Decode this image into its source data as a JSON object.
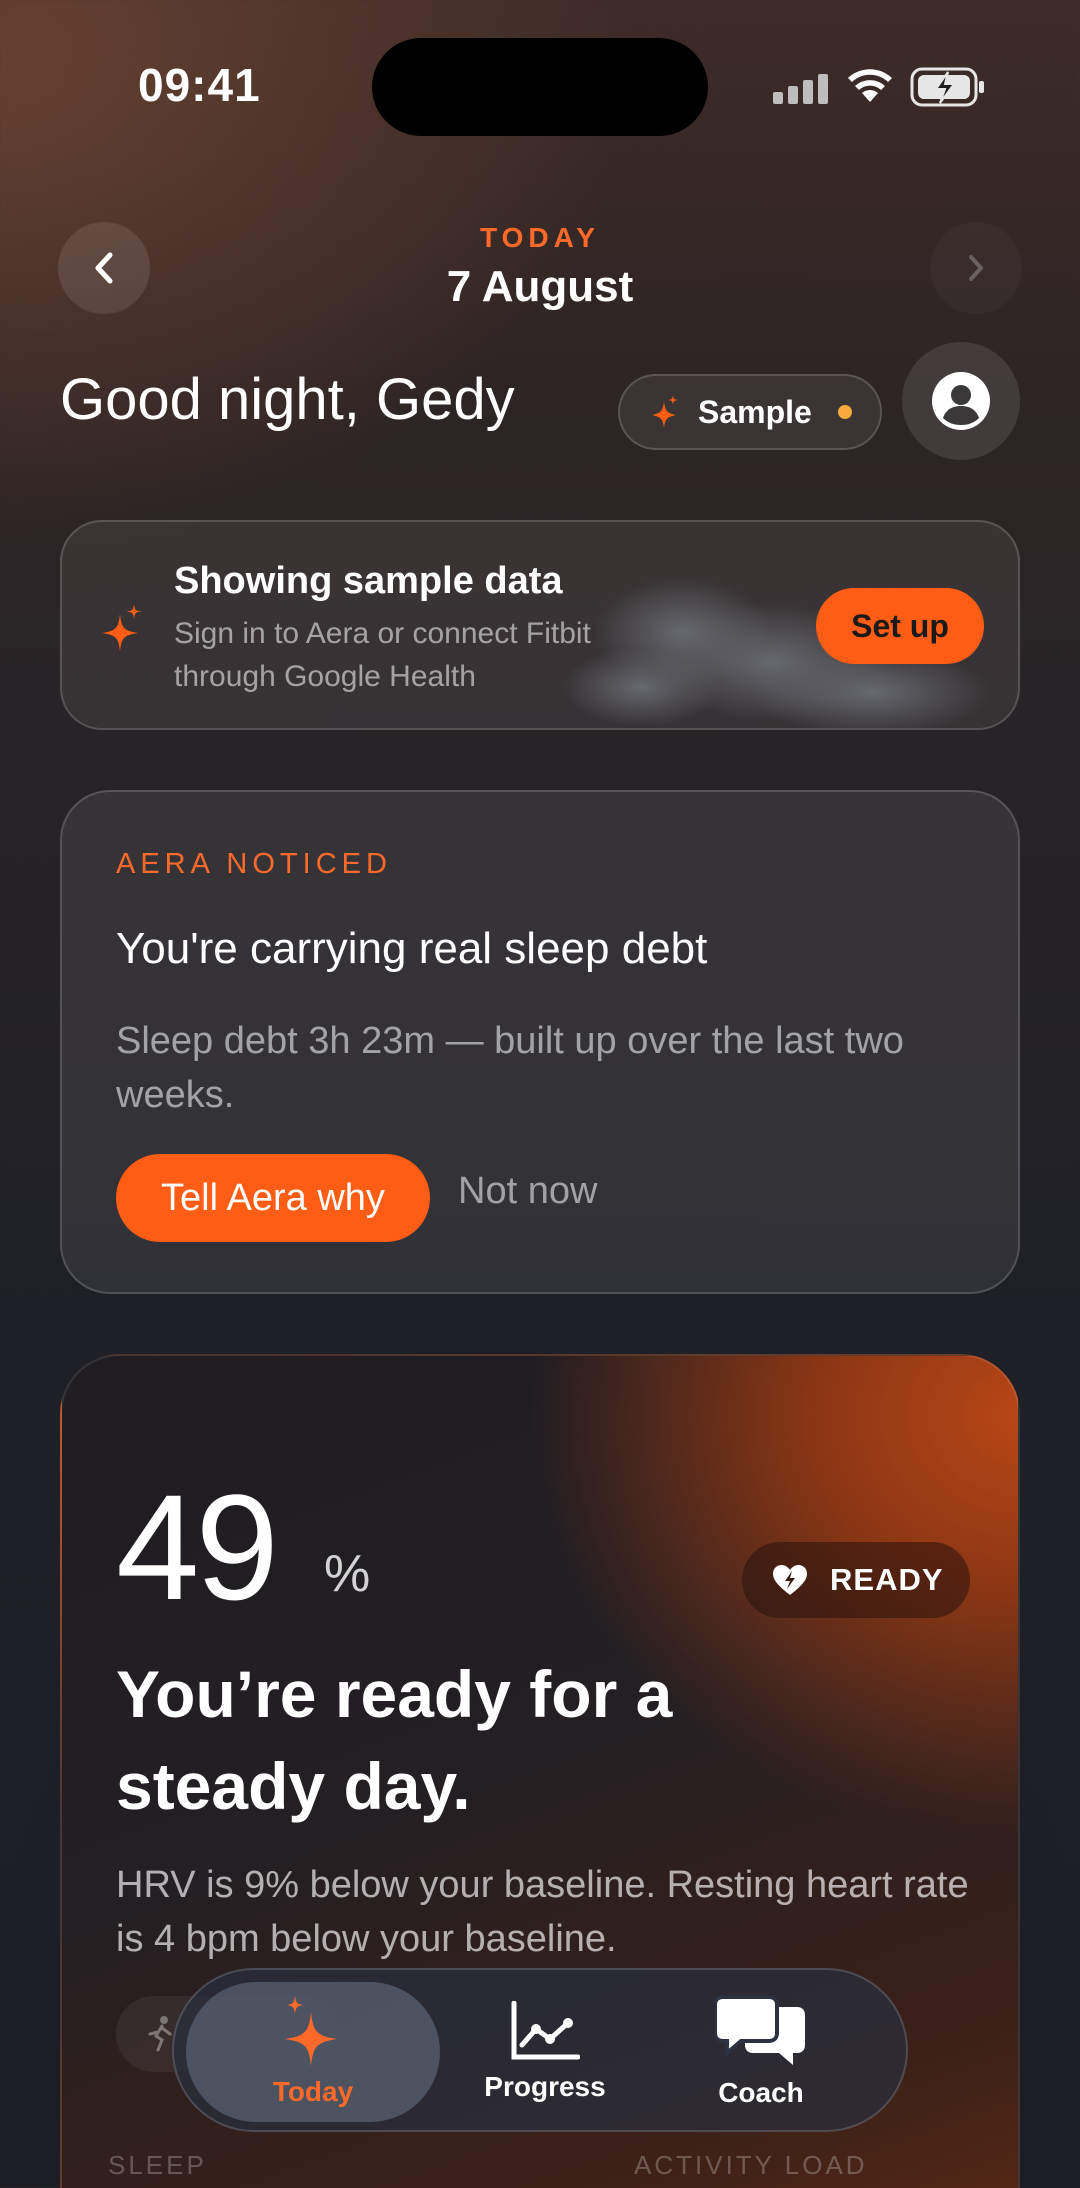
{
  "status_bar": {
    "time": "09:41"
  },
  "header": {
    "date_label": "TODAY",
    "date_value": "7 August",
    "greeting": "Good night, Gedy",
    "sample_pill_label": "Sample"
  },
  "sample_banner": {
    "title": "Showing sample data",
    "subtitle": "Sign in to Aera or connect Fitbit through Google Health",
    "button_label": "Set up"
  },
  "insight": {
    "tag": "AERA NOTICED",
    "title": "You're carrying real sleep debt",
    "body": "Sleep debt 3h 23m — built up over the last two weeks.",
    "primary_button": "Tell Aera why",
    "secondary_button": "Not now"
  },
  "readiness": {
    "score": "49",
    "unit": "%",
    "badge": "READY",
    "headline": "You’re ready for a steady day.",
    "body": "HRV is 9% below your baseline. Resting heart rate is 4 bpm below your baseline.",
    "metrics": [
      "SLEEP",
      "ACTIVITY LOAD"
    ]
  },
  "tabs": [
    {
      "label": "Today",
      "icon": "sparkle-icon",
      "active": true
    },
    {
      "label": "Progress",
      "icon": "chart-icon",
      "active": false
    },
    {
      "label": "Coach",
      "icon": "chat-bubbles-icon",
      "active": false
    }
  ],
  "colors": {
    "accent": "#ff5d15",
    "accent_text": "#ff6a2a",
    "sample_dot": "#f7a93b"
  }
}
